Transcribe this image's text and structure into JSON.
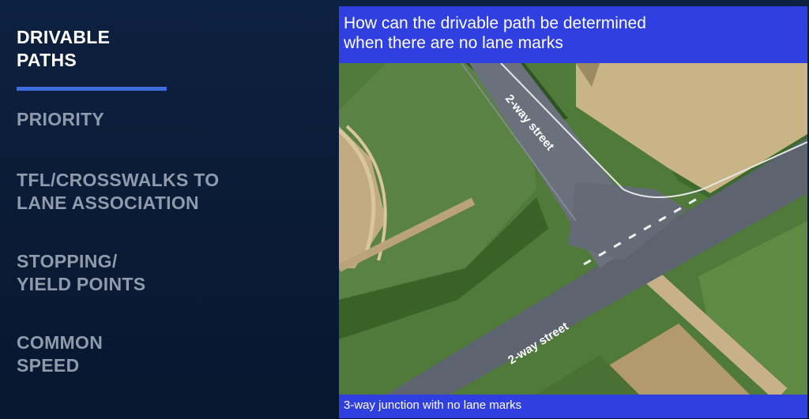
{
  "nav": {
    "items": [
      {
        "label": "DRIVABLE\nPATHS",
        "active": true
      },
      {
        "label": "PRIORITY",
        "active": false
      },
      {
        "label": "TFL/CROSSWALKS  TO\nLANE ASSOCIATION",
        "active": false
      },
      {
        "label": "STOPPING/\nYIELD POINTS",
        "active": false
      },
      {
        "label": "COMMON\nSPEED",
        "active": false
      }
    ]
  },
  "panel": {
    "title": "How can the drivable path be determined\nwhen there are no lane marks",
    "road_label_top": "2-way street",
    "road_label_bottom": "2-way street",
    "caption": "3-way junction with no lane marks"
  },
  "colors": {
    "background": "#0b1c38",
    "accent_blue": "#2f3fe0",
    "active_bar": "#3d6de0",
    "nav_inactive": "#8f9aab",
    "nav_active": "#ffffff"
  }
}
